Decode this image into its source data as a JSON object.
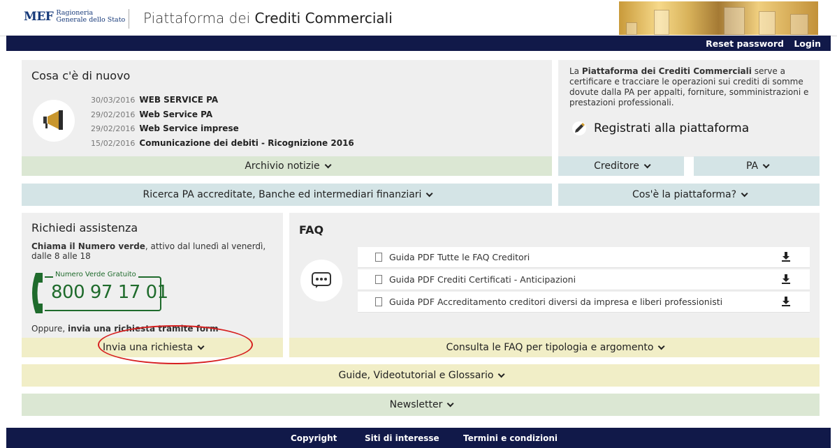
{
  "header": {
    "logo_mef": "MEF",
    "logo_line1": "Ragioneria",
    "logo_line2": "Generale dello Stato",
    "title_prefix": "Piattaforma dei ",
    "title_bold": "Crediti Commerciali"
  },
  "nav": {
    "reset_password": "Reset password",
    "login": "Login"
  },
  "news": {
    "title": "Cosa c'è di nuovo",
    "items": [
      {
        "date": "30/03/2016",
        "title": "WEB SERVICE PA"
      },
      {
        "date": "29/02/2016",
        "title": "Web Service PA"
      },
      {
        "date": "29/02/2016",
        "title": "Web Service imprese"
      },
      {
        "date": "15/02/2016",
        "title": "Comunicazione dei debiti - Ricognizione 2016"
      }
    ],
    "archive_label": "Archivio notizie"
  },
  "info": {
    "text_prefix": "La ",
    "text_bold": "Piattaforma dei Crediti Commerciali",
    "text_suffix": " serve a certificare e tracciare le operazioni sui crediti di somme dovute dalla PA per appalti, forniture, somministrazioni e prestazioni professionali.",
    "register_label": "Registrati alla piattaforma",
    "creditore_label": "Creditore",
    "pa_label": "PA"
  },
  "search_bar": {
    "label": "Ricerca PA accreditate, Banche ed intermediari finanziari"
  },
  "about_bar": {
    "label": "Cos'è la piattaforma?"
  },
  "assistance": {
    "title": "Richiedi assistenza",
    "call_bold": "Chiama il Numero verde",
    "call_rest": ", attivo dal lunedì al venerdì, dalle 8 alle 18",
    "numero_label": "Numero Verde Gratuito",
    "numero": "800 97 17 01",
    "oppure_prefix": "Oppure, ",
    "oppure_bold": "invia una richiesta tramite form",
    "send_label": "Invia una richiesta"
  },
  "faq": {
    "title": "FAQ",
    "items": [
      "Guida PDF Tutte le FAQ Creditori",
      "Guida PDF Crediti Certificati - Anticipazioni",
      "Guida PDF Accreditamento creditori diversi da impresa e liberi professionisti"
    ],
    "consult_label": "Consulta le FAQ per tipologia e argomento"
  },
  "guides": {
    "label": "Guide, Videotutorial e Glossario"
  },
  "newsletter": {
    "label": "Newsletter"
  },
  "footer": {
    "copyright": "Copyright",
    "siti": "Siti di interesse",
    "termini": "Termini e condizioni"
  },
  "colors": {
    "navy": "#111949",
    "green_bar": "#dbe7d3",
    "blue_bar": "#d4e4e6",
    "yellow_bar": "#f1eec7",
    "panel": "#efefef",
    "numero_green": "#1f6b2c",
    "annotation_red": "#d62020"
  }
}
